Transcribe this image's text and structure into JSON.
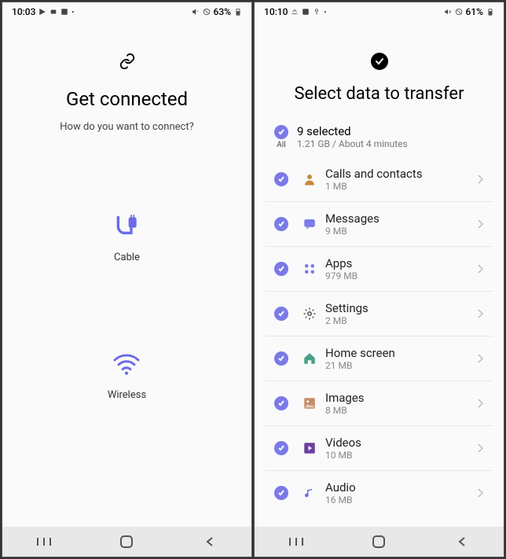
{
  "left": {
    "status": {
      "time": "10:03",
      "battery": "63%"
    },
    "title": "Get connected",
    "subtitle": "How do you want to connect?",
    "option_cable": "Cable",
    "option_wireless": "Wireless"
  },
  "right": {
    "status": {
      "time": "10:10",
      "battery": "61%"
    },
    "title": "Select data to transfer",
    "all_label": "All",
    "selected_text": "9 selected",
    "selected_sub": "1.21 GB / About 4 minutes",
    "items": [
      {
        "title": "Calls and contacts",
        "sub": "1 MB",
        "icon": "person",
        "color": "#c78a3f"
      },
      {
        "title": "Messages",
        "sub": "9 MB",
        "icon": "chat",
        "color": "#7a7ae8"
      },
      {
        "title": "Apps",
        "sub": "979 MB",
        "icon": "grid",
        "color": "#7a7ae8"
      },
      {
        "title": "Settings",
        "sub": "2 MB",
        "icon": "gear",
        "color": "#555"
      },
      {
        "title": "Home screen",
        "sub": "21 MB",
        "icon": "home",
        "color": "#4aa08a"
      },
      {
        "title": "Images",
        "sub": "8 MB",
        "icon": "image",
        "color": "#c78a6a"
      },
      {
        "title": "Videos",
        "sub": "10 MB",
        "icon": "play",
        "color": "#6a3fa0"
      },
      {
        "title": "Audio",
        "sub": "16 MB",
        "icon": "music",
        "color": "#6a6ae8"
      }
    ]
  }
}
